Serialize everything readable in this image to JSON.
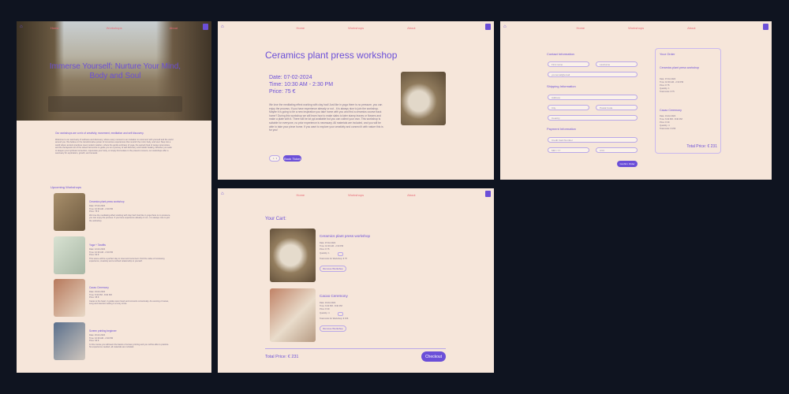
{
  "nav": {
    "home": "Home",
    "workshops": "Workshops",
    "about": "About"
  },
  "home_page": {
    "hero_title": "Immerse Yourself: Nurture Your Mind, Body and Soul",
    "intro_heading": "Our workshops are a mix of creativity, movement, meditation and self discovery.",
    "intro_text": "Welcome to our sanctuary of wellness and discovery, where every moment is an invitation to reconnect with yourself and the world around you. We believe in the transformative power of immersive experiences that nourish the mind, body, and soul. Step into a world where ancient practices meet modern wisdom, where the gentle embrace of yoga, the sacred ritual of cacao ceremonies, and the therapeutic art of the wheel harmonize to guide you on a journey of self discovery and holistic healing. Whether you seek to deepen your spiritual connection, rejuvenate your body, or simply find solace in the present moment, our workshops offer a sanctuary for exploration, growth, and renewal.",
    "upcoming_heading": "Upcoming Workshops",
    "workshops": [
      {
        "title": "Ceramics plant press workshop",
        "date": "Date: 07-02-2024",
        "time": "Time: 10:30 AM - 2:30 PM",
        "price": "Price: 75 €",
        "desc": "We love the meditating effect working with clay had! Just like in yoga there is no pressure, you can enjoy the process. If you have experience already or not - it is always nice to join the workshop."
      },
      {
        "title": "Yoga + Tarafits",
        "date": "Date: 12-02-2024",
        "time": "Time: 10:30 AM - 2:30 PM",
        "price": "Price: 60 €",
        "desc": "This scene will be a perfect day to reset and reconnect. Find the value of constancy, experience, creativity and a refined relationship to yourself."
      },
      {
        "title": "Cacao Ceremony",
        "date": "Date: 19-02-2024",
        "time": "Time: 6:30 PM - 8:30 PM",
        "price": "Price: 35 €",
        "desc": "Cacao is the heart, it guides open heart and connects consciously. An evening of cacao, song and intention setting in a cosy circle."
      },
      {
        "title": "Screen printing beginner",
        "date": "Date: 26-02-2024",
        "time": "Time: 10:30 AM - 2:30 PM",
        "price": "Price: 90 €",
        "desc": "In this course you will learn the basics of screen printing and you will be able to practice. No experience needed, all materials are included."
      }
    ]
  },
  "detail_page": {
    "title": "Ceramics plant press workshop",
    "date": "Date: 07-02-2024",
    "time": "Time: 10:30 AM - 2:30 PM",
    "price": "Price: 75 €",
    "description": "We love the meditating effect working with clay had! Just like in yoga there is no pressure, you can enjoy the process. If you have experience already or not - it is always nice to join the workshop. Maybe it is going to be a new inspiration you take home with you and find a ceramics course back home? During this workshop we will learn how to make slabs to later stamp leaves or flowers and make a plate with it. There will be lot ppl available but you can collect your own. This workshop is suitable for everyone, no prior experience is necessary. All materials are included, and you will be able to take your piece home. If you want to explore your creativity and connect it with nature this is for you!",
    "quantity": "1",
    "book_label": "Book Ticket"
  },
  "checkout_page": {
    "contact_heading": "Contact Information",
    "first_name": "First name",
    "last_name": "Lastname",
    "email": "youremail@email",
    "shipping_heading": "Shipping Information",
    "address": "Address",
    "city": "City",
    "postal": "Postal Code",
    "country": "Country",
    "payment_heading": "Payment Information",
    "card": "Credit Card Number",
    "expiry": "MM / YY",
    "cvc": "CVC",
    "confirm_label": "Confirm Order",
    "order_heading": "Your Order",
    "order_items": [
      {
        "title": "Ceramics plant press workshop",
        "date": "Date: 07-02-2024",
        "time": "Time: 10:30 AM - 2:30 PM",
        "price": "Price: € 75",
        "qty": "Quantity: 1",
        "total": "Total costs: € 75"
      },
      {
        "title": "Cacao Ceremony",
        "date": "Date: 19-02-2024",
        "time": "Time: 6:30 PM - 8:30 PM",
        "price": "Price: € 39",
        "qty": "Quantity: 4",
        "total": "Total costs: € 156"
      }
    ],
    "total": "Total Price: € 231"
  },
  "cart_page": {
    "heading": "Your Cart:",
    "items": [
      {
        "title": "Ceramics plant press workshop",
        "date": "Date: 07-02-2024",
        "time": "Time: 10:30 AM - 2:30 PM",
        "price": "Price: € 75",
        "qty_label": "Quantity: 1",
        "total": "Total costs for Workshop: € 75",
        "remove": "Remove Workshop"
      },
      {
        "title": "Cacao Ceremony",
        "date": "Date: 19-02-2024",
        "time": "Time: 6:30 PM - 8:30 PM",
        "price": "Price: € 39",
        "qty_label": "Quantity: 4",
        "total": "Total costs for Workshop: € 156",
        "remove": "Remove Workshop"
      }
    ],
    "total": "Total Price: € 231",
    "checkout_label": "Checkout"
  },
  "colors": {
    "accent": "#6b4fd8",
    "nav_link": "#e86a76",
    "background": "#f6e6da",
    "page_bg": "#0f1420"
  }
}
